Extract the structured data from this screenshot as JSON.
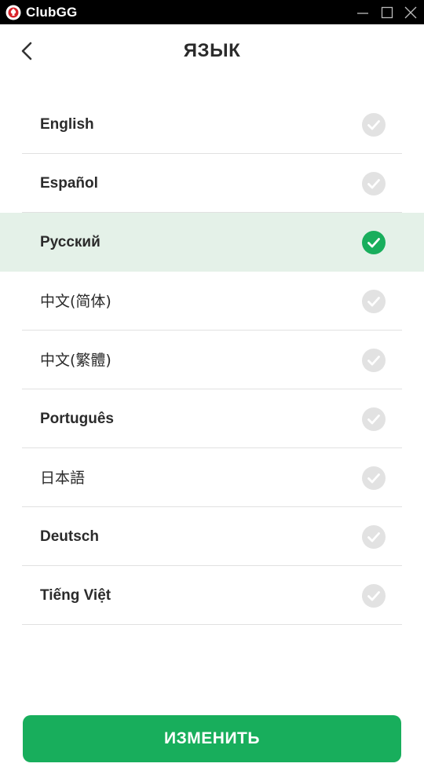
{
  "window": {
    "app_name": "ClubGG",
    "controls": [
      "minimize-icon",
      "maximize-icon",
      "close-icon"
    ]
  },
  "header": {
    "title": "ЯЗЫК",
    "back_icon": "chevron-left-icon"
  },
  "languages": [
    {
      "label": "English",
      "selected": false
    },
    {
      "label": "Español",
      "selected": false
    },
    {
      "label": "Русский",
      "selected": true
    },
    {
      "label": "中文(简体)",
      "selected": false
    },
    {
      "label": "中文(繁體)",
      "selected": false
    },
    {
      "label": "Português",
      "selected": false
    },
    {
      "label": "日本語",
      "selected": false
    },
    {
      "label": "Deutsch",
      "selected": false
    },
    {
      "label": "Tiếng Việt",
      "selected": false
    }
  ],
  "confirm_button": {
    "label": "ИЗМЕНИТЬ"
  },
  "colors": {
    "accent_green": "#18ae5c",
    "selected_row_bg": "#e4f1e8",
    "check_inactive": "#e2e2e2",
    "title_bar": "#000000"
  }
}
